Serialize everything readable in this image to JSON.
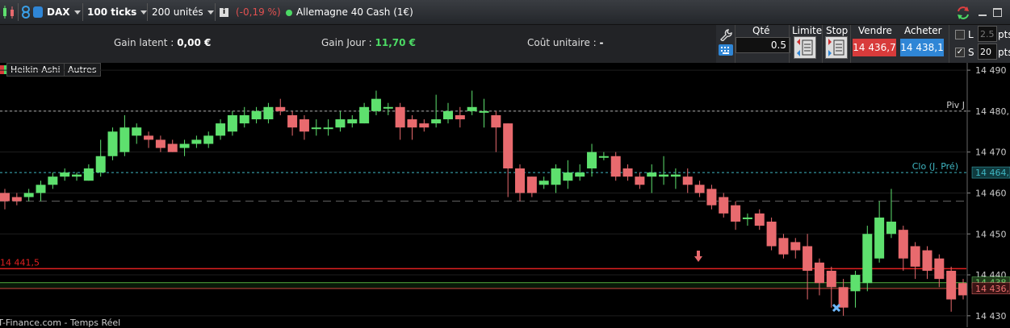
{
  "toolbar": {
    "symbol": "DAX",
    "ticks": "100 ticks",
    "units": "200 unités",
    "info_icon": "i",
    "change": "(-0,19 %)",
    "instrument": "Allemagne 40 Cash (1€)"
  },
  "infobar": {
    "gain_latent_label": "Gain latent :",
    "gain_latent_value": "0,00 €",
    "gain_jour_label": "Gain Jour :",
    "gain_jour_value": "11,70 €",
    "cout_label": "Coût unitaire :",
    "cout_value": "-"
  },
  "order": {
    "qty_label": "Qté",
    "qty_value": "0.5",
    "limit_label": "Limite",
    "stop_label": "Stop",
    "sell_label": "Vendre",
    "sell_price": "14 436,7",
    "buy_label": "Acheter",
    "buy_price": "14 438,1",
    "l_label": "L",
    "l_value": "2.5",
    "l_unit": "pts",
    "s_label": "S",
    "s_value": "20",
    "s_unit": "pts"
  },
  "chart_tabs": [
    "Heikin-Ashi",
    "Autres"
  ],
  "colors": {
    "up": "#5ee06e",
    "down": "#e86a6e",
    "sell": "#d83b3b",
    "buy": "#2f86d6",
    "gain": "#4cd964"
  },
  "chart_data": {
    "type": "candlestick",
    "ylim": [
      14428,
      14491
    ],
    "yticks": [
      14490,
      14480,
      14470,
      14460,
      14450,
      14440,
      14430
    ],
    "ytick_labels": [
      "14 490",
      "14 480,",
      "14 470",
      "14 460",
      "14 450",
      "14 440",
      "14 430"
    ],
    "levels": [
      {
        "name": "Piv J",
        "value": 14480.0,
        "label": "14 480,",
        "style": "dashed",
        "color": "#aaaaaa"
      },
      {
        "name": "Clo (J. Pré)",
        "value": 14465.0,
        "label": "14 464,",
        "style": "dashed",
        "color": "#3fb6c2"
      },
      {
        "name": "",
        "value": 14458.0,
        "label": "",
        "style": "longdash",
        "color": "#666666"
      },
      {
        "name": "14 441,5",
        "value": 14441.5,
        "label": "",
        "style": "solid",
        "color": "#e02020"
      },
      {
        "name": "",
        "value": 14438.1,
        "label": "14 438,",
        "style": "solid",
        "color": "#4a9a3a"
      },
      {
        "name": "",
        "value": 14436.7,
        "label": "14 436,",
        "style": "solid",
        "color": "#c83c3c"
      }
    ],
    "footer": "IT-Finance.com - Temps Réel",
    "candles": [
      {
        "o": 14460,
        "c": 14458,
        "h": 14461,
        "l": 14456
      },
      {
        "o": 14459,
        "c": 14458,
        "h": 14460,
        "l": 14457
      },
      {
        "o": 14459,
        "c": 14460,
        "h": 14461,
        "l": 14458
      },
      {
        "o": 14460,
        "c": 14462,
        "h": 14463,
        "l": 14458
      },
      {
        "o": 14462,
        "c": 14464,
        "h": 14465,
        "l": 14461
      },
      {
        "o": 14464,
        "c": 14465,
        "h": 14466,
        "l": 14463
      },
      {
        "o": 14464,
        "c": 14464.5,
        "h": 14465,
        "l": 14463
      },
      {
        "o": 14463,
        "c": 14466,
        "h": 14467,
        "l": 14463
      },
      {
        "o": 14465,
        "c": 14469,
        "h": 14473,
        "l": 14464
      },
      {
        "o": 14469,
        "c": 14475,
        "h": 14476,
        "l": 14468
      },
      {
        "o": 14470,
        "c": 14476,
        "h": 14479,
        "l": 14469
      },
      {
        "o": 14474,
        "c": 14476,
        "h": 14477,
        "l": 14472
      },
      {
        "o": 14474,
        "c": 14473,
        "h": 14475,
        "l": 14471
      },
      {
        "o": 14473,
        "c": 14471,
        "h": 14474,
        "l": 14470
      },
      {
        "o": 14472,
        "c": 14470,
        "h": 14473,
        "l": 14470
      },
      {
        "o": 14471,
        "c": 14472,
        "h": 14473,
        "l": 14469
      },
      {
        "o": 14472,
        "c": 14473,
        "h": 14474,
        "l": 14471
      },
      {
        "o": 14472,
        "c": 14474,
        "h": 14475,
        "l": 14471
      },
      {
        "o": 14474,
        "c": 14477,
        "h": 14478,
        "l": 14473
      },
      {
        "o": 14475,
        "c": 14479,
        "h": 14480,
        "l": 14474
      },
      {
        "o": 14477,
        "c": 14479,
        "h": 14481,
        "l": 14476
      },
      {
        "o": 14478,
        "c": 14480,
        "h": 14481,
        "l": 14477
      },
      {
        "o": 14478,
        "c": 14481,
        "h": 14482,
        "l": 14477
      },
      {
        "o": 14481,
        "c": 14480,
        "h": 14483,
        "l": 14479
      },
      {
        "o": 14479,
        "c": 14476,
        "h": 14480,
        "l": 14474
      },
      {
        "o": 14478,
        "c": 14475,
        "h": 14479,
        "l": 14473
      },
      {
        "o": 14476,
        "c": 14476,
        "h": 14478,
        "l": 14474
      },
      {
        "o": 14476,
        "c": 14476,
        "h": 14478,
        "l": 14474
      },
      {
        "o": 14476,
        "c": 14478,
        "h": 14480,
        "l": 14475
      },
      {
        "o": 14477,
        "c": 14478,
        "h": 14479,
        "l": 14476
      },
      {
        "o": 14477,
        "c": 14481,
        "h": 14482,
        "l": 14477
      },
      {
        "o": 14480,
        "c": 14483,
        "h": 14485,
        "l": 14479
      },
      {
        "o": 14481,
        "c": 14481,
        "h": 14482,
        "l": 14479
      },
      {
        "o": 14481,
        "c": 14476,
        "h": 14482,
        "l": 14473
      },
      {
        "o": 14478,
        "c": 14476,
        "h": 14479,
        "l": 14473
      },
      {
        "o": 14477,
        "c": 14476,
        "h": 14478,
        "l": 14475
      },
      {
        "o": 14477,
        "c": 14478,
        "h": 14484,
        "l": 14476
      },
      {
        "o": 14478,
        "c": 14480,
        "h": 14482,
        "l": 14477
      },
      {
        "o": 14479,
        "c": 14478,
        "h": 14481,
        "l": 14476
      },
      {
        "o": 14480,
        "c": 14481,
        "h": 14485,
        "l": 14479
      },
      {
        "o": 14480,
        "c": 14480,
        "h": 14483,
        "l": 14476
      },
      {
        "o": 14479,
        "c": 14476,
        "h": 14480,
        "l": 14470
      },
      {
        "o": 14477,
        "c": 14466,
        "h": 14477,
        "l": 14459
      },
      {
        "o": 14466,
        "c": 14460,
        "h": 14467,
        "l": 14458
      },
      {
        "o": 14464,
        "c": 14460,
        "h": 14464,
        "l": 14459
      },
      {
        "o": 14462,
        "c": 14463,
        "h": 14464,
        "l": 14461
      },
      {
        "o": 14462,
        "c": 14466,
        "h": 14467,
        "l": 14460
      },
      {
        "o": 14463,
        "c": 14465,
        "h": 14468,
        "l": 14461
      },
      {
        "o": 14464,
        "c": 14465,
        "h": 14467,
        "l": 14463
      },
      {
        "o": 14466,
        "c": 14470,
        "h": 14472,
        "l": 14464
      },
      {
        "o": 14469,
        "c": 14469,
        "h": 14470,
        "l": 14468
      },
      {
        "o": 14469,
        "c": 14464,
        "h": 14470,
        "l": 14463
      },
      {
        "o": 14466,
        "c": 14464,
        "h": 14467,
        "l": 14463
      },
      {
        "o": 14464,
        "c": 14462,
        "h": 14465,
        "l": 14461
      },
      {
        "o": 14464,
        "c": 14465,
        "h": 14467,
        "l": 14460
      },
      {
        "o": 14464,
        "c": 14464.5,
        "h": 14469,
        "l": 14462
      },
      {
        "o": 14464,
        "c": 14464.5,
        "h": 14466,
        "l": 14461
      },
      {
        "o": 14464,
        "c": 14462,
        "h": 14466,
        "l": 14460
      },
      {
        "o": 14462,
        "c": 14460,
        "h": 14463,
        "l": 14459
      },
      {
        "o": 14461,
        "c": 14457,
        "h": 14462,
        "l": 14456
      },
      {
        "o": 14459,
        "c": 14455,
        "h": 14460,
        "l": 14454
      },
      {
        "o": 14457,
        "c": 14453,
        "h": 14458,
        "l": 14451
      },
      {
        "o": 14454,
        "c": 14454,
        "h": 14455,
        "l": 14452
      },
      {
        "o": 14455,
        "c": 14452,
        "h": 14456,
        "l": 14451
      },
      {
        "o": 14453,
        "c": 14447,
        "h": 14454,
        "l": 14446
      },
      {
        "o": 14449,
        "c": 14445,
        "h": 14450,
        "l": 14444
      },
      {
        "o": 14448,
        "c": 14446,
        "h": 14449,
        "l": 14444
      },
      {
        "o": 14447,
        "c": 14441,
        "h": 14450,
        "l": 14434
      },
      {
        "o": 14443,
        "c": 14438,
        "h": 14444,
        "l": 14435
      },
      {
        "o": 14441,
        "c": 14437,
        "h": 14442,
        "l": 14432
      },
      {
        "o": 14437,
        "c": 14432,
        "h": 14439,
        "l": 14430
      },
      {
        "o": 14436,
        "c": 14440,
        "h": 14441,
        "l": 14432
      },
      {
        "o": 14438,
        "c": 14450,
        "h": 14452,
        "l": 14436
      },
      {
        "o": 14444,
        "c": 14454,
        "h": 14458,
        "l": 14443
      },
      {
        "o": 14450,
        "c": 14453,
        "h": 14461,
        "l": 14449
      },
      {
        "o": 14451,
        "c": 14444,
        "h": 14452,
        "l": 14441
      },
      {
        "o": 14447,
        "c": 14442,
        "h": 14448,
        "l": 14439
      },
      {
        "o": 14446,
        "c": 14441,
        "h": 14447,
        "l": 14439
      },
      {
        "o": 14444,
        "c": 14439,
        "h": 14445,
        "l": 14437
      },
      {
        "o": 14441,
        "c": 14434,
        "h": 14442,
        "l": 14431
      },
      {
        "o": 14438,
        "c": 14435,
        "h": 14439,
        "l": 14434
      }
    ]
  }
}
